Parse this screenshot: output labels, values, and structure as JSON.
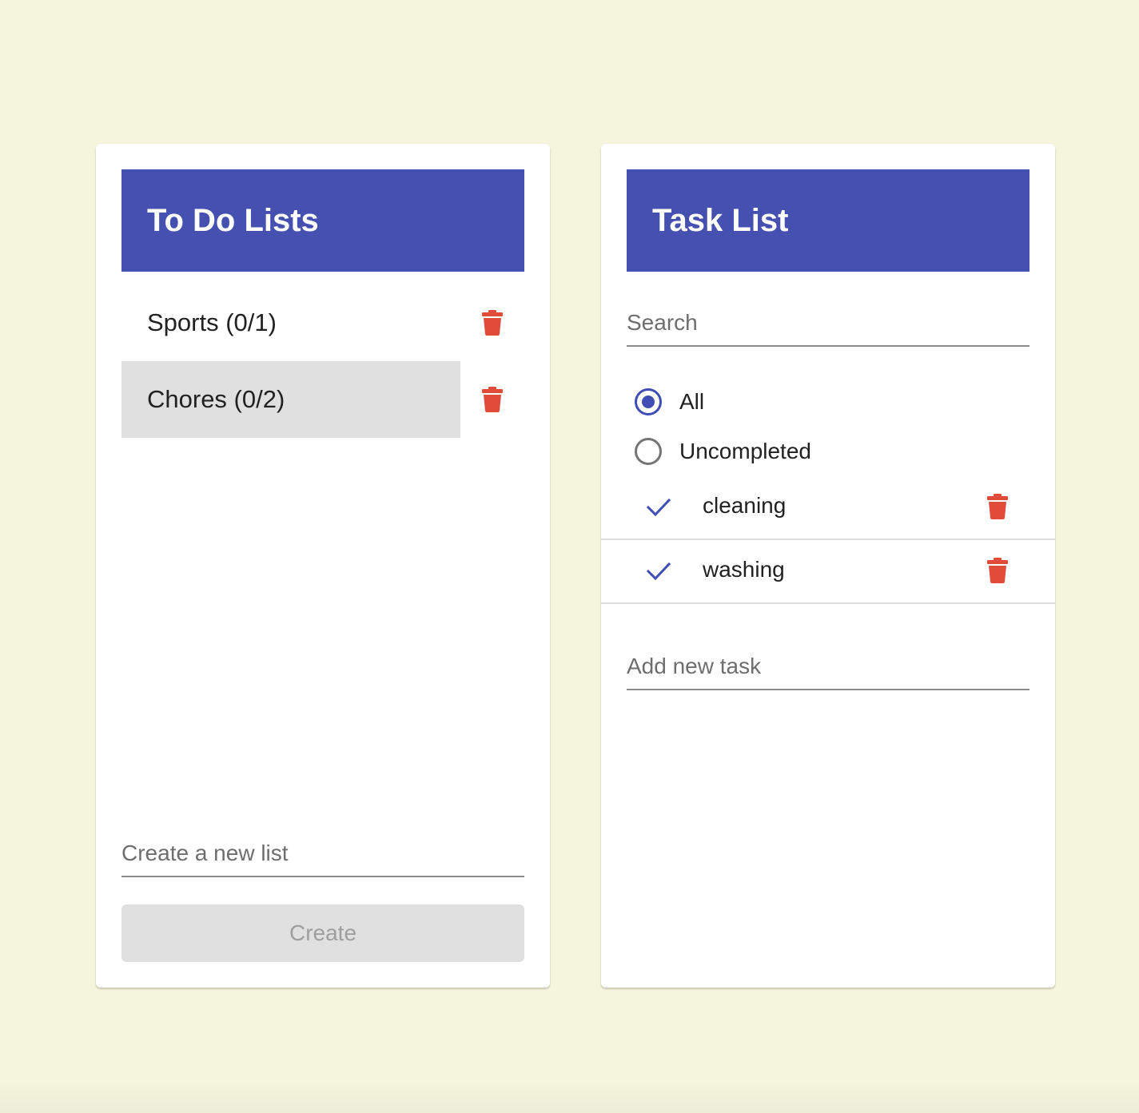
{
  "colors": {
    "page_background": "#f5f5de",
    "header_background": "#4550b0",
    "accent": "#3f4db5",
    "delete": "#e04b3a",
    "selected_row": "#e0e0e0"
  },
  "lists_panel": {
    "title": "To Do Lists",
    "lists": [
      {
        "label": "Sports (0/1)",
        "selected": false,
        "delete_icon": "trash-icon"
      },
      {
        "label": "Chores (0/2)",
        "selected": true,
        "delete_icon": "trash-icon"
      }
    ],
    "new_list_input": {
      "value": "",
      "placeholder": "Create a new list"
    },
    "create_button": {
      "label": "Create",
      "enabled": false
    }
  },
  "tasks_panel": {
    "title": "Task List",
    "search_input": {
      "value": "",
      "placeholder": "Search"
    },
    "filter": {
      "options": [
        {
          "label": "All",
          "checked": true
        },
        {
          "label": "Uncompleted",
          "checked": false
        }
      ]
    },
    "tasks": [
      {
        "label": "cleaning",
        "status_icon": "check-icon",
        "delete_icon": "trash-icon"
      },
      {
        "label": "washing",
        "status_icon": "check-icon",
        "delete_icon": "trash-icon"
      }
    ],
    "new_task_input": {
      "value": "",
      "placeholder": "Add new task"
    }
  }
}
